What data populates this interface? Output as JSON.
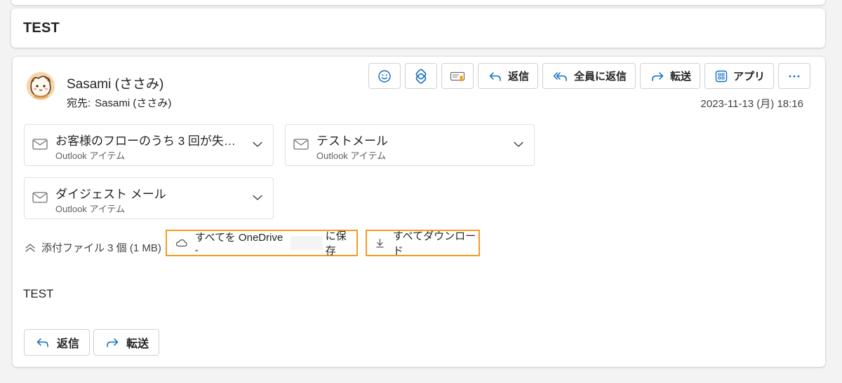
{
  "subject": "TEST",
  "message": {
    "sender_name": "Sasami (ささみ)",
    "recipient_label": "宛先:",
    "recipient_name": "Sasami (ささみ)",
    "datetime": "2023-11-13 (月) 18:16",
    "body_text": "TEST"
  },
  "toolbar": {
    "reply_label": "返信",
    "reply_all_label": "全員に返信",
    "forward_label": "転送",
    "apps_label": "アプリ"
  },
  "attachments": {
    "items": [
      {
        "title": "お客様のフローのうち 3 回が失…",
        "subtitle": "Outlook アイテム"
      },
      {
        "title": "テストメール",
        "subtitle": "Outlook アイテム"
      },
      {
        "title": "ダイジェスト メール",
        "subtitle": "Outlook アイテム"
      }
    ],
    "summary": "添付ファイル 3 個 (1 MB)",
    "save_all_prefix": "すべてを OneDrive -",
    "save_all_suffix": "に保存",
    "download_all": "すべてダウンロード"
  },
  "footer": {
    "reply_label": "返信",
    "forward_label": "転送"
  },
  "colors": {
    "highlight_border": "#f59b23",
    "accent_blue": "#0f6cbd"
  },
  "icons": [
    "emoji-icon",
    "loop-icon",
    "immersive-reader-icon",
    "reply-icon",
    "reply-all-icon",
    "forward-icon",
    "apps-icon",
    "more-icon",
    "mail-icon",
    "chevron-down-icon",
    "chevron-up-icon",
    "cloud-icon",
    "download-icon"
  ]
}
